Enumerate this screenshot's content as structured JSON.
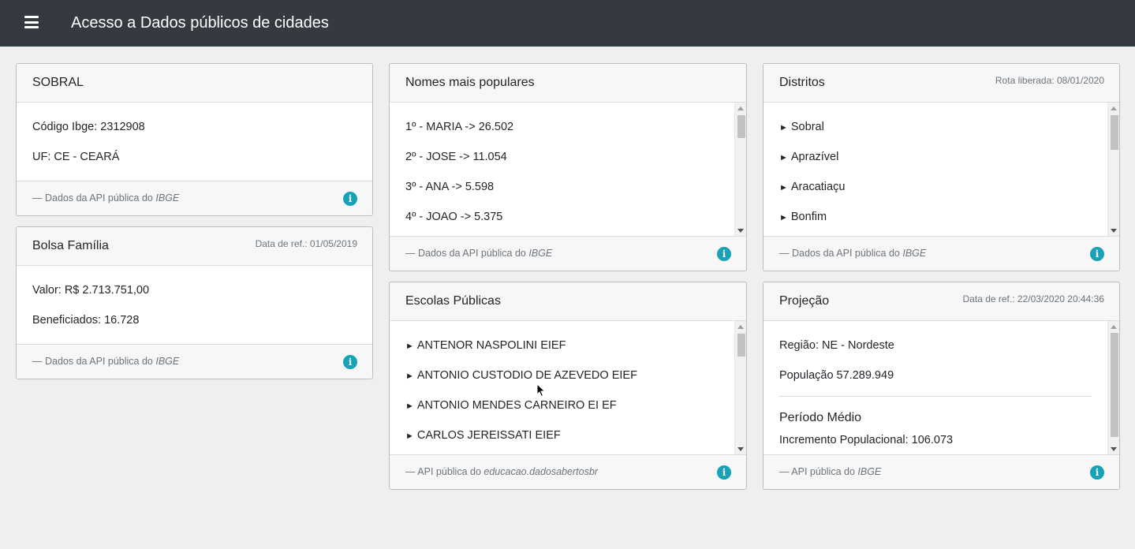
{
  "header": {
    "menu_icon": "hamburger-icon",
    "title": "Acesso a Dados públicos de cidades"
  },
  "colors": {
    "topbar": "#343a40",
    "info": "#17a2b8",
    "background": "#efefef"
  },
  "city": {
    "name": "SOBRAL",
    "codigo": "Código Ibge: 2312908",
    "uf": "UF: CE - CEARÁ",
    "footer_prefix": "Dados da API pública do ",
    "footer_source": "IBGE"
  },
  "bolsa": {
    "title": "Bolsa Família",
    "ref": "Data de ref.: 01/05/2019",
    "valor": "Valor: R$ 2.713.751,00",
    "beneficiados": "Beneficiados: 16.728",
    "footer_prefix": "Dados da API pública do ",
    "footer_source": "IBGE"
  },
  "nomes": {
    "title": "Nomes mais populares",
    "items": [
      "1º - MARIA -> 26.502",
      "2º - JOSE -> 11.054",
      "3º - ANA -> 5.598",
      "4º - JOAO -> 5.375"
    ],
    "footer_prefix": "Dados da API pública do ",
    "footer_source": "IBGE"
  },
  "distritos": {
    "title": "Distritos",
    "ref": "Rota liberada: 08/01/2020",
    "items": [
      "Sobral",
      "Aprazível",
      "Aracatiaçu",
      "Bonfim"
    ],
    "footer_prefix": "Dados da API pública do ",
    "footer_source": "IBGE"
  },
  "escolas": {
    "title": "Escolas Públicas",
    "items": [
      "ANTENOR NASPOLINI EIEF",
      "ANTONIO CUSTODIO DE AZEVEDO EIEF",
      "ANTONIO MENDES CARNEIRO EI EF",
      "CARLOS JEREISSATI EIEF"
    ],
    "footer_prefix": "API pública do ",
    "footer_source": "educacao.dadosabertosbr"
  },
  "projecao": {
    "title": "Projeção",
    "ref": "Data de ref.: 22/03/2020 20:44:36",
    "regiao": "Região: NE - Nordeste",
    "populacao": "População 57.289.949",
    "periodo": "Período Médio",
    "incremento": "Incremento Populacional: 106.073",
    "footer_prefix": "API pública do ",
    "footer_source": "IBGE"
  }
}
